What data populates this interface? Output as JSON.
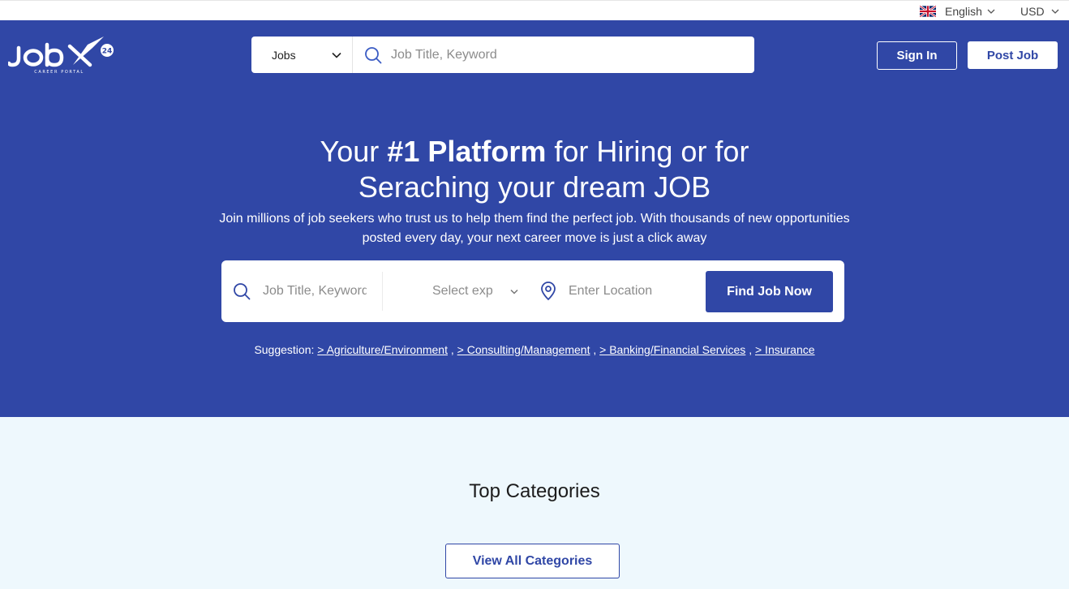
{
  "topbar": {
    "language": "English",
    "currency": "USD",
    "language_icon": "uk-flag-icon",
    "dropdown_icon": "chevron-down-icon"
  },
  "header": {
    "logo_text": "JobX 24",
    "search": {
      "type_selected": "Jobs",
      "placeholder": "Job Title, Keyword"
    },
    "sign_in_label": "Sign In",
    "post_job_label": "Post Job"
  },
  "hero": {
    "title_before": "Your ",
    "title_bold": "#1 Platform",
    "title_after": " for Hiring or for",
    "title_line2": "Seraching your dream JOB",
    "subtitle": "Join millions of job seekers who trust us to help them find the perfect job. With thousands of new opportunities posted every day, your next career move is just a click away"
  },
  "finder": {
    "keyword_placeholder": "Job Title, Keyword",
    "experience_placeholder": "Select exp",
    "location_placeholder": "Enter Location",
    "button_label": "Find Job Now"
  },
  "suggestions": {
    "label": "Suggestion:",
    "items": [
      "> Agriculture/Environment",
      "> Consulting/Management",
      "> Banking/Financial Services",
      "> Insurance"
    ]
  },
  "categories": {
    "title": "Top Categories",
    "view_all_label": "View All Categories"
  },
  "colors": {
    "brand": "#3047a6",
    "section_bg": "#eef8fd"
  }
}
